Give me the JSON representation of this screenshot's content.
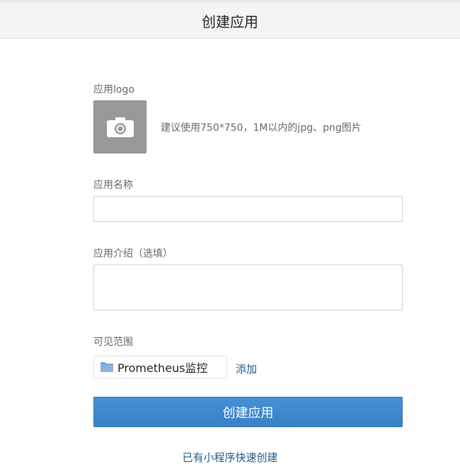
{
  "header": {
    "title": "创建应用"
  },
  "logo": {
    "label": "应用logo",
    "hint": "建议使用750*750，1M以内的jpg、png图片",
    "icon": "camera-icon"
  },
  "app_name": {
    "label": "应用名称",
    "value": "",
    "placeholder": ""
  },
  "app_intro": {
    "label": "应用介绍（选填）",
    "value": "",
    "placeholder": ""
  },
  "visibility": {
    "label": "可见范围",
    "selected": "Prometheus监控",
    "selected_icon": "folder-icon",
    "add_label": "添加"
  },
  "actions": {
    "submit_label": "创建应用",
    "quick_create_label": "已有小程序快速创建"
  },
  "colors": {
    "primary": "#3a81c6",
    "link": "#1d5a8c",
    "logo_placeholder": "#999999",
    "folder": "#7fa3cf"
  }
}
